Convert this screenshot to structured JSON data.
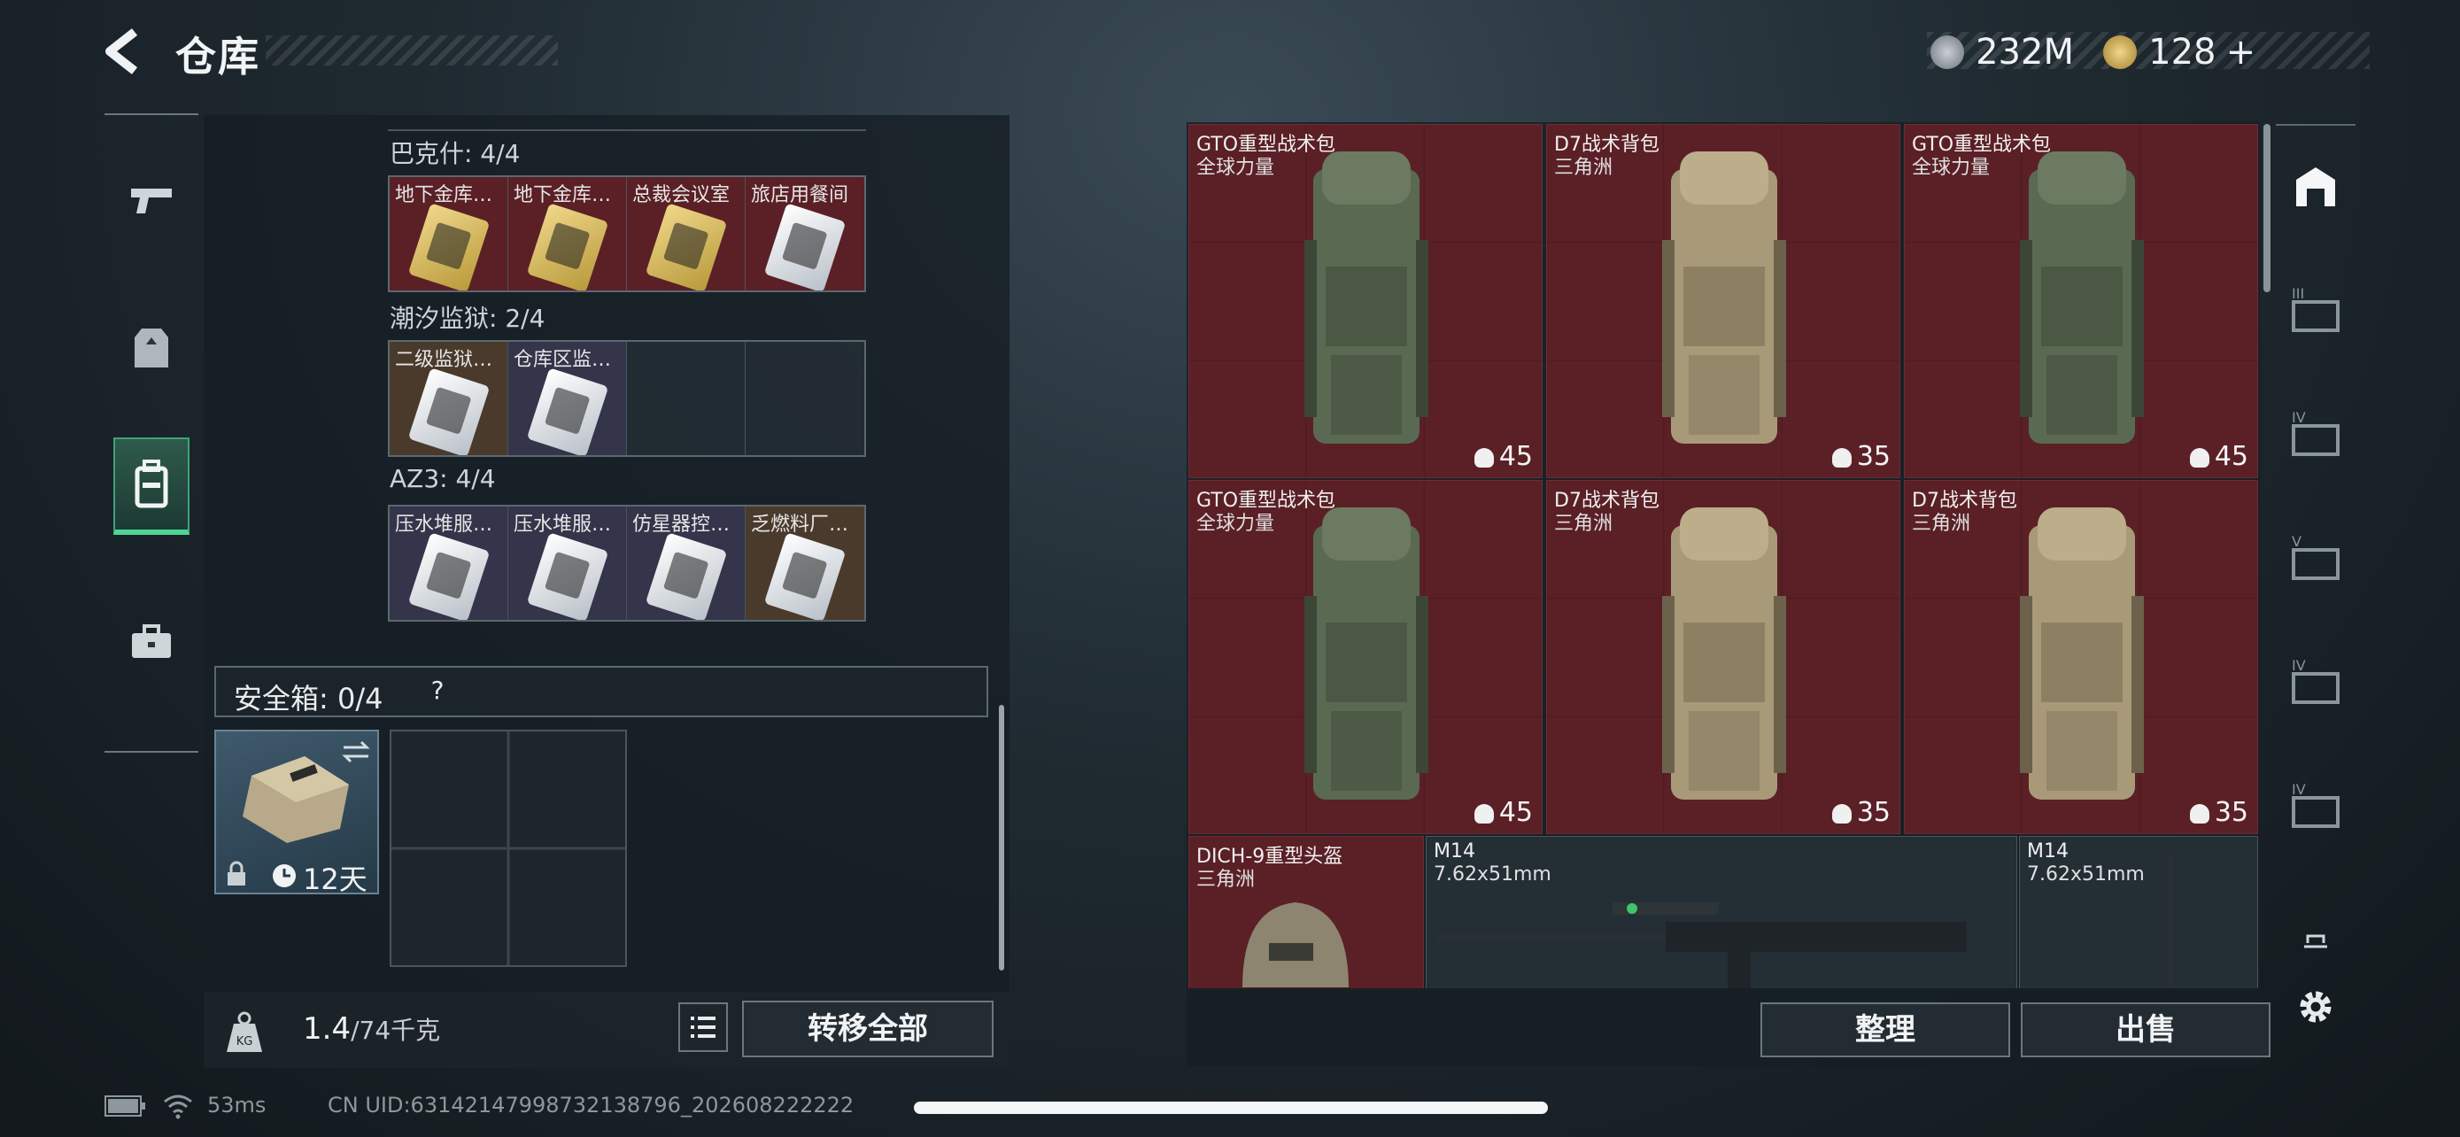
{
  "header": {
    "title": "仓库",
    "currency": [
      {
        "icon": "silver-coin-icon",
        "value": "232M"
      },
      {
        "icon": "gold-coin-icon",
        "value": "128"
      }
    ],
    "add_label": "+"
  },
  "nav": {
    "items": [
      {
        "icon": "weapon-icon",
        "active": false
      },
      {
        "icon": "armor-vest-icon",
        "active": false
      },
      {
        "icon": "backpack-icon",
        "active": true
      },
      {
        "icon": "toolbox-icon",
        "active": false
      }
    ]
  },
  "keycards": {
    "sections": [
      {
        "title": "巴克什: 4/4",
        "slots": [
          {
            "label": "地下金库…",
            "color": "red",
            "card": "gold"
          },
          {
            "label": "地下金库…",
            "color": "red",
            "card": "gold"
          },
          {
            "label": "总裁会议室",
            "color": "red",
            "card": "gold"
          },
          {
            "label": "旅店用餐间",
            "color": "red",
            "card": "white"
          }
        ]
      },
      {
        "title": "潮汐监狱: 2/4",
        "slots": [
          {
            "label": "二级监狱…",
            "color": "brown",
            "card": "white"
          },
          {
            "label": "仓库区监…",
            "color": "purple",
            "card": "white"
          },
          {
            "label": "",
            "color": "empty",
            "card": ""
          },
          {
            "label": "",
            "color": "empty",
            "card": ""
          }
        ]
      },
      {
        "title": "AZ3: 4/4",
        "slots": [
          {
            "label": "压水堆服…",
            "color": "purple",
            "card": "white"
          },
          {
            "label": "压水堆服…",
            "color": "purple",
            "card": "white"
          },
          {
            "label": "仿星器控…",
            "color": "purple",
            "card": "white"
          },
          {
            "label": "乏燃料厂…",
            "color": "brown",
            "card": "white"
          }
        ]
      }
    ]
  },
  "safe_box": {
    "title": "安全箱: 0/4",
    "help": "?",
    "duration": "12天"
  },
  "capacity": {
    "current": "1.4",
    "max": "/74千克",
    "transfer_label": "转移全部"
  },
  "stash": {
    "items": [
      {
        "name": "GTO重型战术包",
        "sub": "全球力量",
        "capacity": "45",
        "color": "green"
      },
      {
        "name": "D7战术背包",
        "sub": "三角洲",
        "capacity": "35",
        "color": "tan"
      },
      {
        "name": "GTO重型战术包",
        "sub": "全球力量",
        "capacity": "45",
        "color": "green"
      },
      {
        "name": "GTO重型战术包",
        "sub": "全球力量",
        "capacity": "45",
        "color": "green"
      },
      {
        "name": "D7战术背包",
        "sub": "三角洲",
        "capacity": "35",
        "color": "tan"
      },
      {
        "name": "D7战术背包",
        "sub": "三角洲",
        "capacity": "35",
        "color": "tan"
      }
    ],
    "bottom_items": [
      {
        "name": "DICH-9重型头盔",
        "sub": "三角洲"
      },
      {
        "name": "M14",
        "sub": "7.62x51mm"
      },
      {
        "name": "M14",
        "sub": "7.62x51mm"
      }
    ],
    "sort_label": "整理",
    "sell_label": "出售"
  },
  "side_filters": [
    "III",
    "IV",
    "V",
    "IV",
    "IV"
  ],
  "status": {
    "ping": "53ms",
    "uid": "CN UID:6314214799873213879​6_202608222222"
  }
}
